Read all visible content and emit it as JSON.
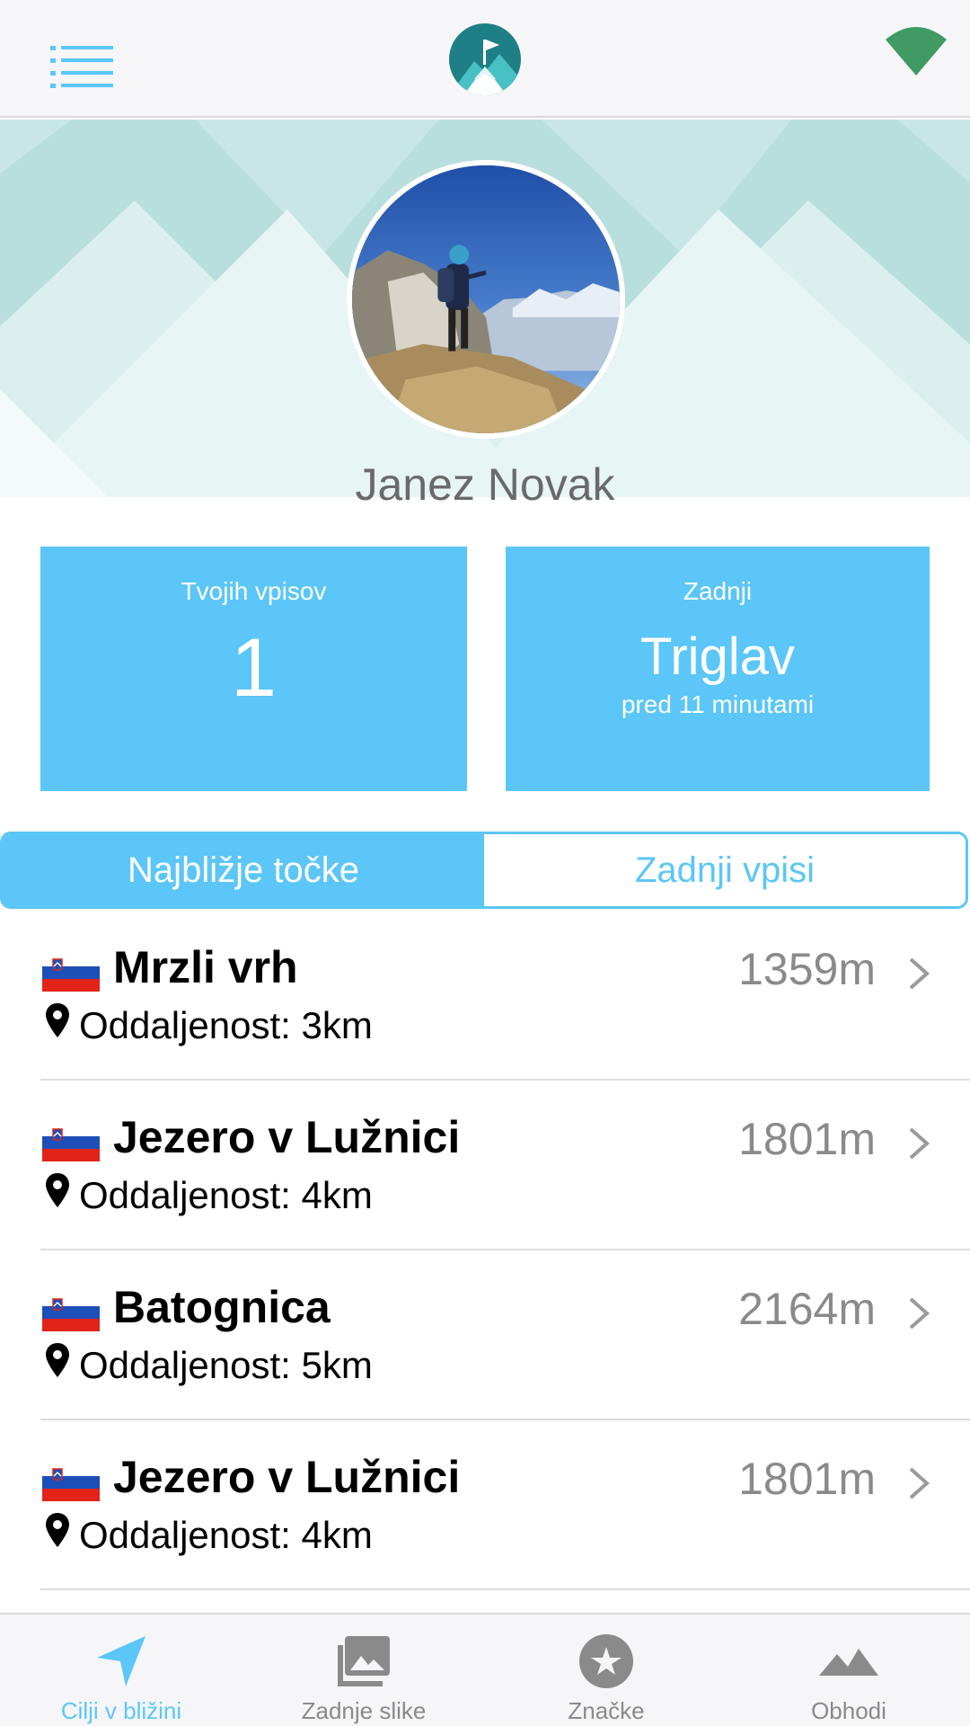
{
  "header": {
    "menu_icon": "hamburger-menu-icon",
    "logo_icon": "mountain-flag-logo",
    "status_icon": "wifi-signal-icon"
  },
  "profile": {
    "name": "Janez Novak",
    "avatar": "hiker-on-summit-photo"
  },
  "stats": {
    "entries_label": "Tvojih vpisov",
    "entries_count": "1",
    "last_label": "Zadnji",
    "last_peak": "Triglav",
    "last_time": "pred 11 minutami"
  },
  "tabs": [
    {
      "label": "Najbližje točke",
      "active": true
    },
    {
      "label": "Zadnji vpisi",
      "active": false
    }
  ],
  "list": [
    {
      "name": "Mrzli vrh",
      "elevation": "1359m",
      "distance": "Oddaljenost: 3km",
      "flag": "slovenia-flag"
    },
    {
      "name": "Jezero v Lužnici",
      "elevation": "1801m",
      "distance": "Oddaljenost: 4km",
      "flag": "slovenia-flag"
    },
    {
      "name": "Batognica",
      "elevation": "2164m",
      "distance": "Oddaljenost: 5km",
      "flag": "slovenia-flag"
    },
    {
      "name": "Jezero v Lužnici",
      "elevation": "1801m",
      "distance": "Oddaljenost: 4km",
      "flag": "slovenia-flag"
    }
  ],
  "bottom_nav": [
    {
      "label": "Cilji v bližini",
      "icon": "navigation-arrow-icon",
      "active": true
    },
    {
      "label": "Zadnje slike",
      "icon": "photos-icon",
      "active": false
    },
    {
      "label": "Značke",
      "icon": "star-badge-icon",
      "active": false
    },
    {
      "label": "Obhodi",
      "icon": "mountains-icon",
      "active": false
    }
  ],
  "colors": {
    "accent": "#5bc6f7",
    "hero_bg": "#cde7e7",
    "logo_teal": "#2aa3a6",
    "wifi_green": "#3f9a63",
    "nav_gray": "#8a8a8a"
  }
}
